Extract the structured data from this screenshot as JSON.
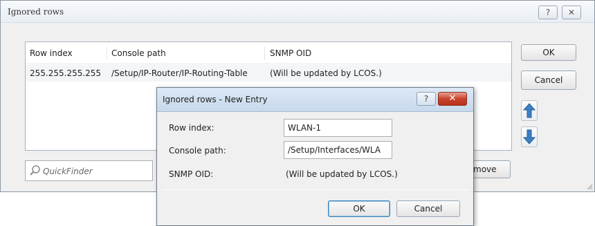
{
  "window": {
    "title": "Ignored rows",
    "help_glyph": "?",
    "close_glyph": "✕"
  },
  "table": {
    "columns": [
      "Row index",
      "Console path",
      "SNMP OID"
    ],
    "rows": [
      {
        "row_index": "255.255.255.255",
        "console_path": "/Setup/IP-Router/IP-Routing-Table",
        "snmp_oid": "(Will be updated by LCOS.)"
      }
    ]
  },
  "buttons": {
    "ok": "OK",
    "cancel": "Cancel",
    "remove_partial": "move"
  },
  "quickfinder": {
    "placeholder": "QuickFinder"
  },
  "modal": {
    "title": "Ignored rows - New Entry",
    "help_glyph": "?",
    "close_glyph": "✕",
    "fields": {
      "row_index_label": "Row index:",
      "row_index_value": "WLAN-1",
      "console_path_label": "Console path:",
      "console_path_value": "/Setup/Interfaces/WLA",
      "snmp_oid_label": "SNMP OID:",
      "snmp_oid_value": "(Will be updated by LCOS.)"
    },
    "ok": "OK",
    "cancel": "Cancel"
  },
  "colors": {
    "arrow_blue": "#3b7fc4",
    "close_red": "#c8432c"
  },
  "icons": [
    "help-icon",
    "close-icon",
    "arrow-up-icon",
    "arrow-down-icon",
    "search-icon",
    "resize-grip-icon"
  ]
}
